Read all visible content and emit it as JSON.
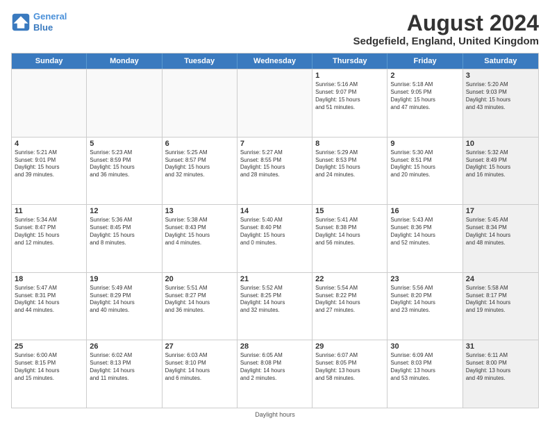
{
  "header": {
    "logo_line1": "General",
    "logo_line2": "Blue",
    "main_title": "August 2024",
    "subtitle": "Sedgefield, England, United Kingdom"
  },
  "days_of_week": [
    "Sunday",
    "Monday",
    "Tuesday",
    "Wednesday",
    "Thursday",
    "Friday",
    "Saturday"
  ],
  "weeks": [
    [
      {
        "day": "",
        "text": "",
        "empty": true
      },
      {
        "day": "",
        "text": "",
        "empty": true
      },
      {
        "day": "",
        "text": "",
        "empty": true
      },
      {
        "day": "",
        "text": "",
        "empty": true
      },
      {
        "day": "1",
        "text": "Sunrise: 5:16 AM\nSunset: 9:07 PM\nDaylight: 15 hours\nand 51 minutes.",
        "empty": false
      },
      {
        "day": "2",
        "text": "Sunrise: 5:18 AM\nSunset: 9:05 PM\nDaylight: 15 hours\nand 47 minutes.",
        "empty": false
      },
      {
        "day": "3",
        "text": "Sunrise: 5:20 AM\nSunset: 9:03 PM\nDaylight: 15 hours\nand 43 minutes.",
        "empty": false,
        "shaded": true
      }
    ],
    [
      {
        "day": "4",
        "text": "Sunrise: 5:21 AM\nSunset: 9:01 PM\nDaylight: 15 hours\nand 39 minutes.",
        "empty": false
      },
      {
        "day": "5",
        "text": "Sunrise: 5:23 AM\nSunset: 8:59 PM\nDaylight: 15 hours\nand 36 minutes.",
        "empty": false
      },
      {
        "day": "6",
        "text": "Sunrise: 5:25 AM\nSunset: 8:57 PM\nDaylight: 15 hours\nand 32 minutes.",
        "empty": false
      },
      {
        "day": "7",
        "text": "Sunrise: 5:27 AM\nSunset: 8:55 PM\nDaylight: 15 hours\nand 28 minutes.",
        "empty": false
      },
      {
        "day": "8",
        "text": "Sunrise: 5:29 AM\nSunset: 8:53 PM\nDaylight: 15 hours\nand 24 minutes.",
        "empty": false
      },
      {
        "day": "9",
        "text": "Sunrise: 5:30 AM\nSunset: 8:51 PM\nDaylight: 15 hours\nand 20 minutes.",
        "empty": false
      },
      {
        "day": "10",
        "text": "Sunrise: 5:32 AM\nSunset: 8:49 PM\nDaylight: 15 hours\nand 16 minutes.",
        "empty": false,
        "shaded": true
      }
    ],
    [
      {
        "day": "11",
        "text": "Sunrise: 5:34 AM\nSunset: 8:47 PM\nDaylight: 15 hours\nand 12 minutes.",
        "empty": false
      },
      {
        "day": "12",
        "text": "Sunrise: 5:36 AM\nSunset: 8:45 PM\nDaylight: 15 hours\nand 8 minutes.",
        "empty": false
      },
      {
        "day": "13",
        "text": "Sunrise: 5:38 AM\nSunset: 8:43 PM\nDaylight: 15 hours\nand 4 minutes.",
        "empty": false
      },
      {
        "day": "14",
        "text": "Sunrise: 5:40 AM\nSunset: 8:40 PM\nDaylight: 15 hours\nand 0 minutes.",
        "empty": false
      },
      {
        "day": "15",
        "text": "Sunrise: 5:41 AM\nSunset: 8:38 PM\nDaylight: 14 hours\nand 56 minutes.",
        "empty": false
      },
      {
        "day": "16",
        "text": "Sunrise: 5:43 AM\nSunset: 8:36 PM\nDaylight: 14 hours\nand 52 minutes.",
        "empty": false
      },
      {
        "day": "17",
        "text": "Sunrise: 5:45 AM\nSunset: 8:34 PM\nDaylight: 14 hours\nand 48 minutes.",
        "empty": false,
        "shaded": true
      }
    ],
    [
      {
        "day": "18",
        "text": "Sunrise: 5:47 AM\nSunset: 8:31 PM\nDaylight: 14 hours\nand 44 minutes.",
        "empty": false
      },
      {
        "day": "19",
        "text": "Sunrise: 5:49 AM\nSunset: 8:29 PM\nDaylight: 14 hours\nand 40 minutes.",
        "empty": false
      },
      {
        "day": "20",
        "text": "Sunrise: 5:51 AM\nSunset: 8:27 PM\nDaylight: 14 hours\nand 36 minutes.",
        "empty": false
      },
      {
        "day": "21",
        "text": "Sunrise: 5:52 AM\nSunset: 8:25 PM\nDaylight: 14 hours\nand 32 minutes.",
        "empty": false
      },
      {
        "day": "22",
        "text": "Sunrise: 5:54 AM\nSunset: 8:22 PM\nDaylight: 14 hours\nand 27 minutes.",
        "empty": false
      },
      {
        "day": "23",
        "text": "Sunrise: 5:56 AM\nSunset: 8:20 PM\nDaylight: 14 hours\nand 23 minutes.",
        "empty": false
      },
      {
        "day": "24",
        "text": "Sunrise: 5:58 AM\nSunset: 8:17 PM\nDaylight: 14 hours\nand 19 minutes.",
        "empty": false,
        "shaded": true
      }
    ],
    [
      {
        "day": "25",
        "text": "Sunrise: 6:00 AM\nSunset: 8:15 PM\nDaylight: 14 hours\nand 15 minutes.",
        "empty": false
      },
      {
        "day": "26",
        "text": "Sunrise: 6:02 AM\nSunset: 8:13 PM\nDaylight: 14 hours\nand 11 minutes.",
        "empty": false
      },
      {
        "day": "27",
        "text": "Sunrise: 6:03 AM\nSunset: 8:10 PM\nDaylight: 14 hours\nand 6 minutes.",
        "empty": false
      },
      {
        "day": "28",
        "text": "Sunrise: 6:05 AM\nSunset: 8:08 PM\nDaylight: 14 hours\nand 2 minutes.",
        "empty": false
      },
      {
        "day": "29",
        "text": "Sunrise: 6:07 AM\nSunset: 8:05 PM\nDaylight: 13 hours\nand 58 minutes.",
        "empty": false
      },
      {
        "day": "30",
        "text": "Sunrise: 6:09 AM\nSunset: 8:03 PM\nDaylight: 13 hours\nand 53 minutes.",
        "empty": false
      },
      {
        "day": "31",
        "text": "Sunrise: 6:11 AM\nSunset: 8:00 PM\nDaylight: 13 hours\nand 49 minutes.",
        "empty": false,
        "shaded": true
      }
    ]
  ],
  "footer": "Daylight hours"
}
